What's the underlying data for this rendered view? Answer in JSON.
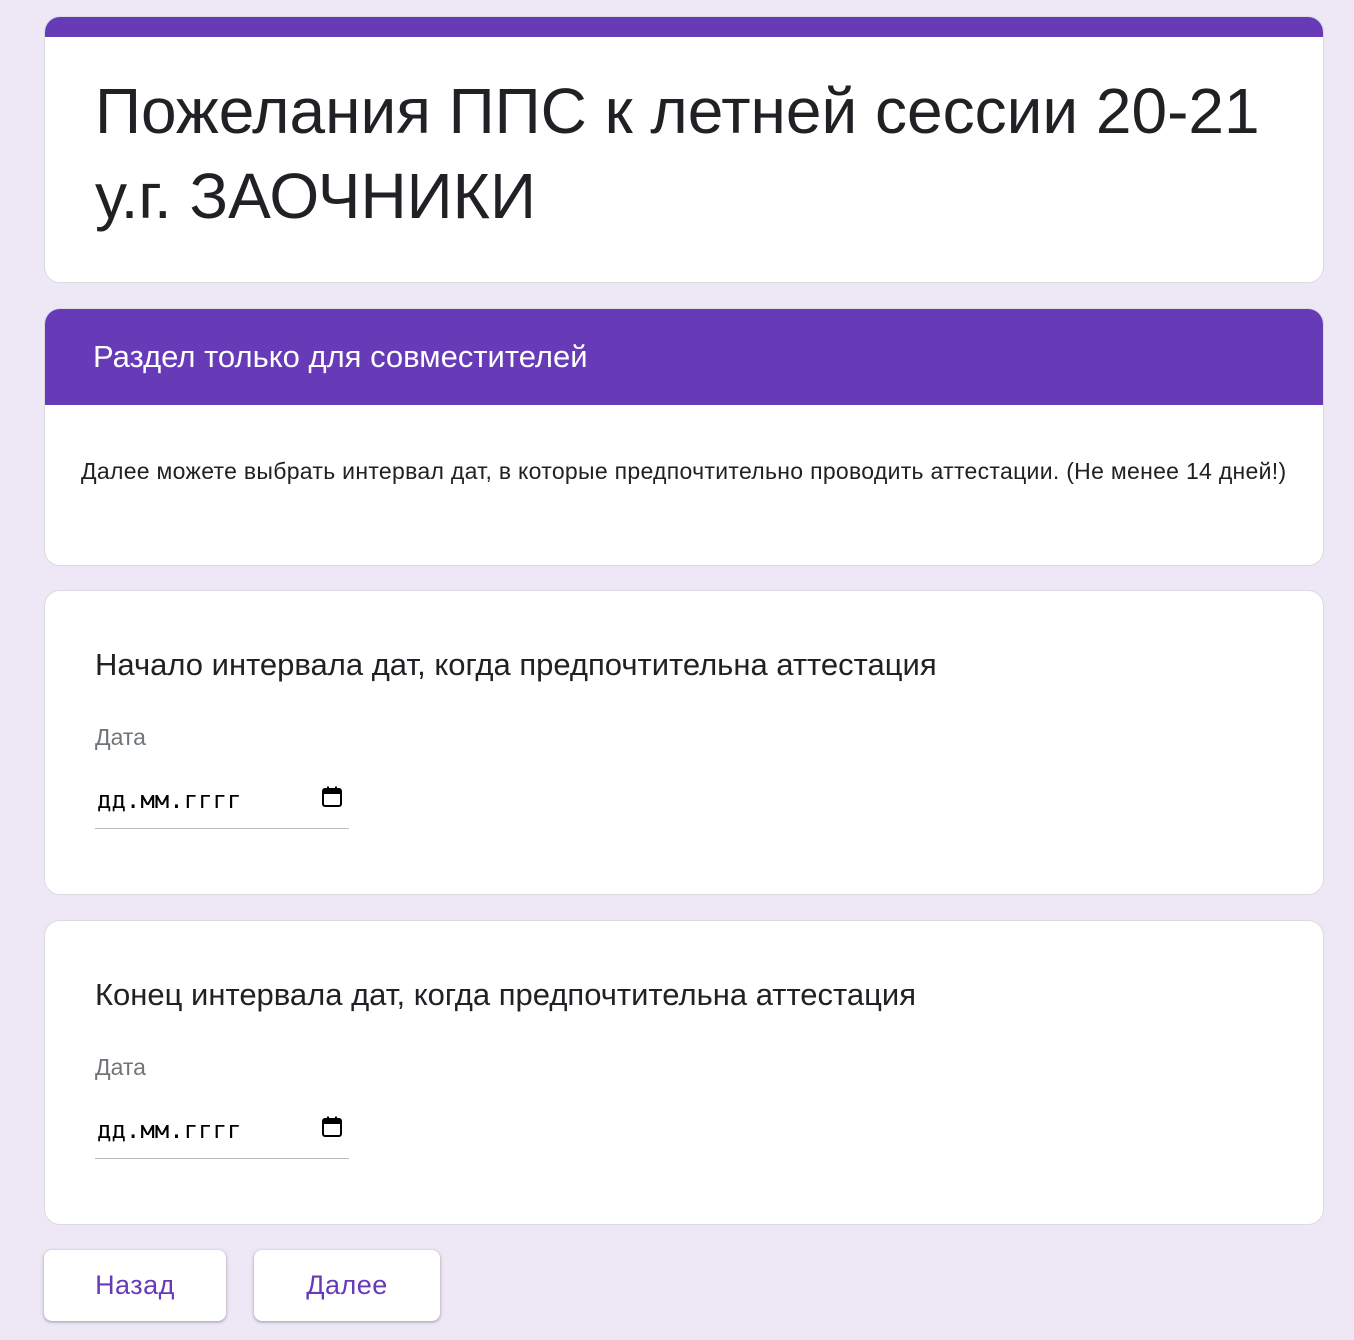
{
  "form": {
    "title": "Пожелания ППС к летней сессии 20-21 у.г. ЗАОЧНИКИ",
    "accent_color": "#673ab7",
    "background_color": "#ede7f6"
  },
  "section": {
    "title": "Раздел только для совместителей",
    "description": "Далее можете выбрать интервал дат, в которые предпочтительно проводить аттестации. (Не менее 14 дней!)"
  },
  "questions": [
    {
      "title": "Начало интервала дат, когда предпочтительна аттестация",
      "field_label": "Дата",
      "placeholder": "дд.мм.гггг",
      "icon": "calendar-icon"
    },
    {
      "title": "Конец интервала дат, когда предпочтительна аттестация",
      "field_label": "Дата",
      "placeholder": "дд.мм.гггг",
      "icon": "calendar-icon"
    }
  ],
  "navigation": {
    "back_label": "Назад",
    "next_label": "Далее"
  }
}
